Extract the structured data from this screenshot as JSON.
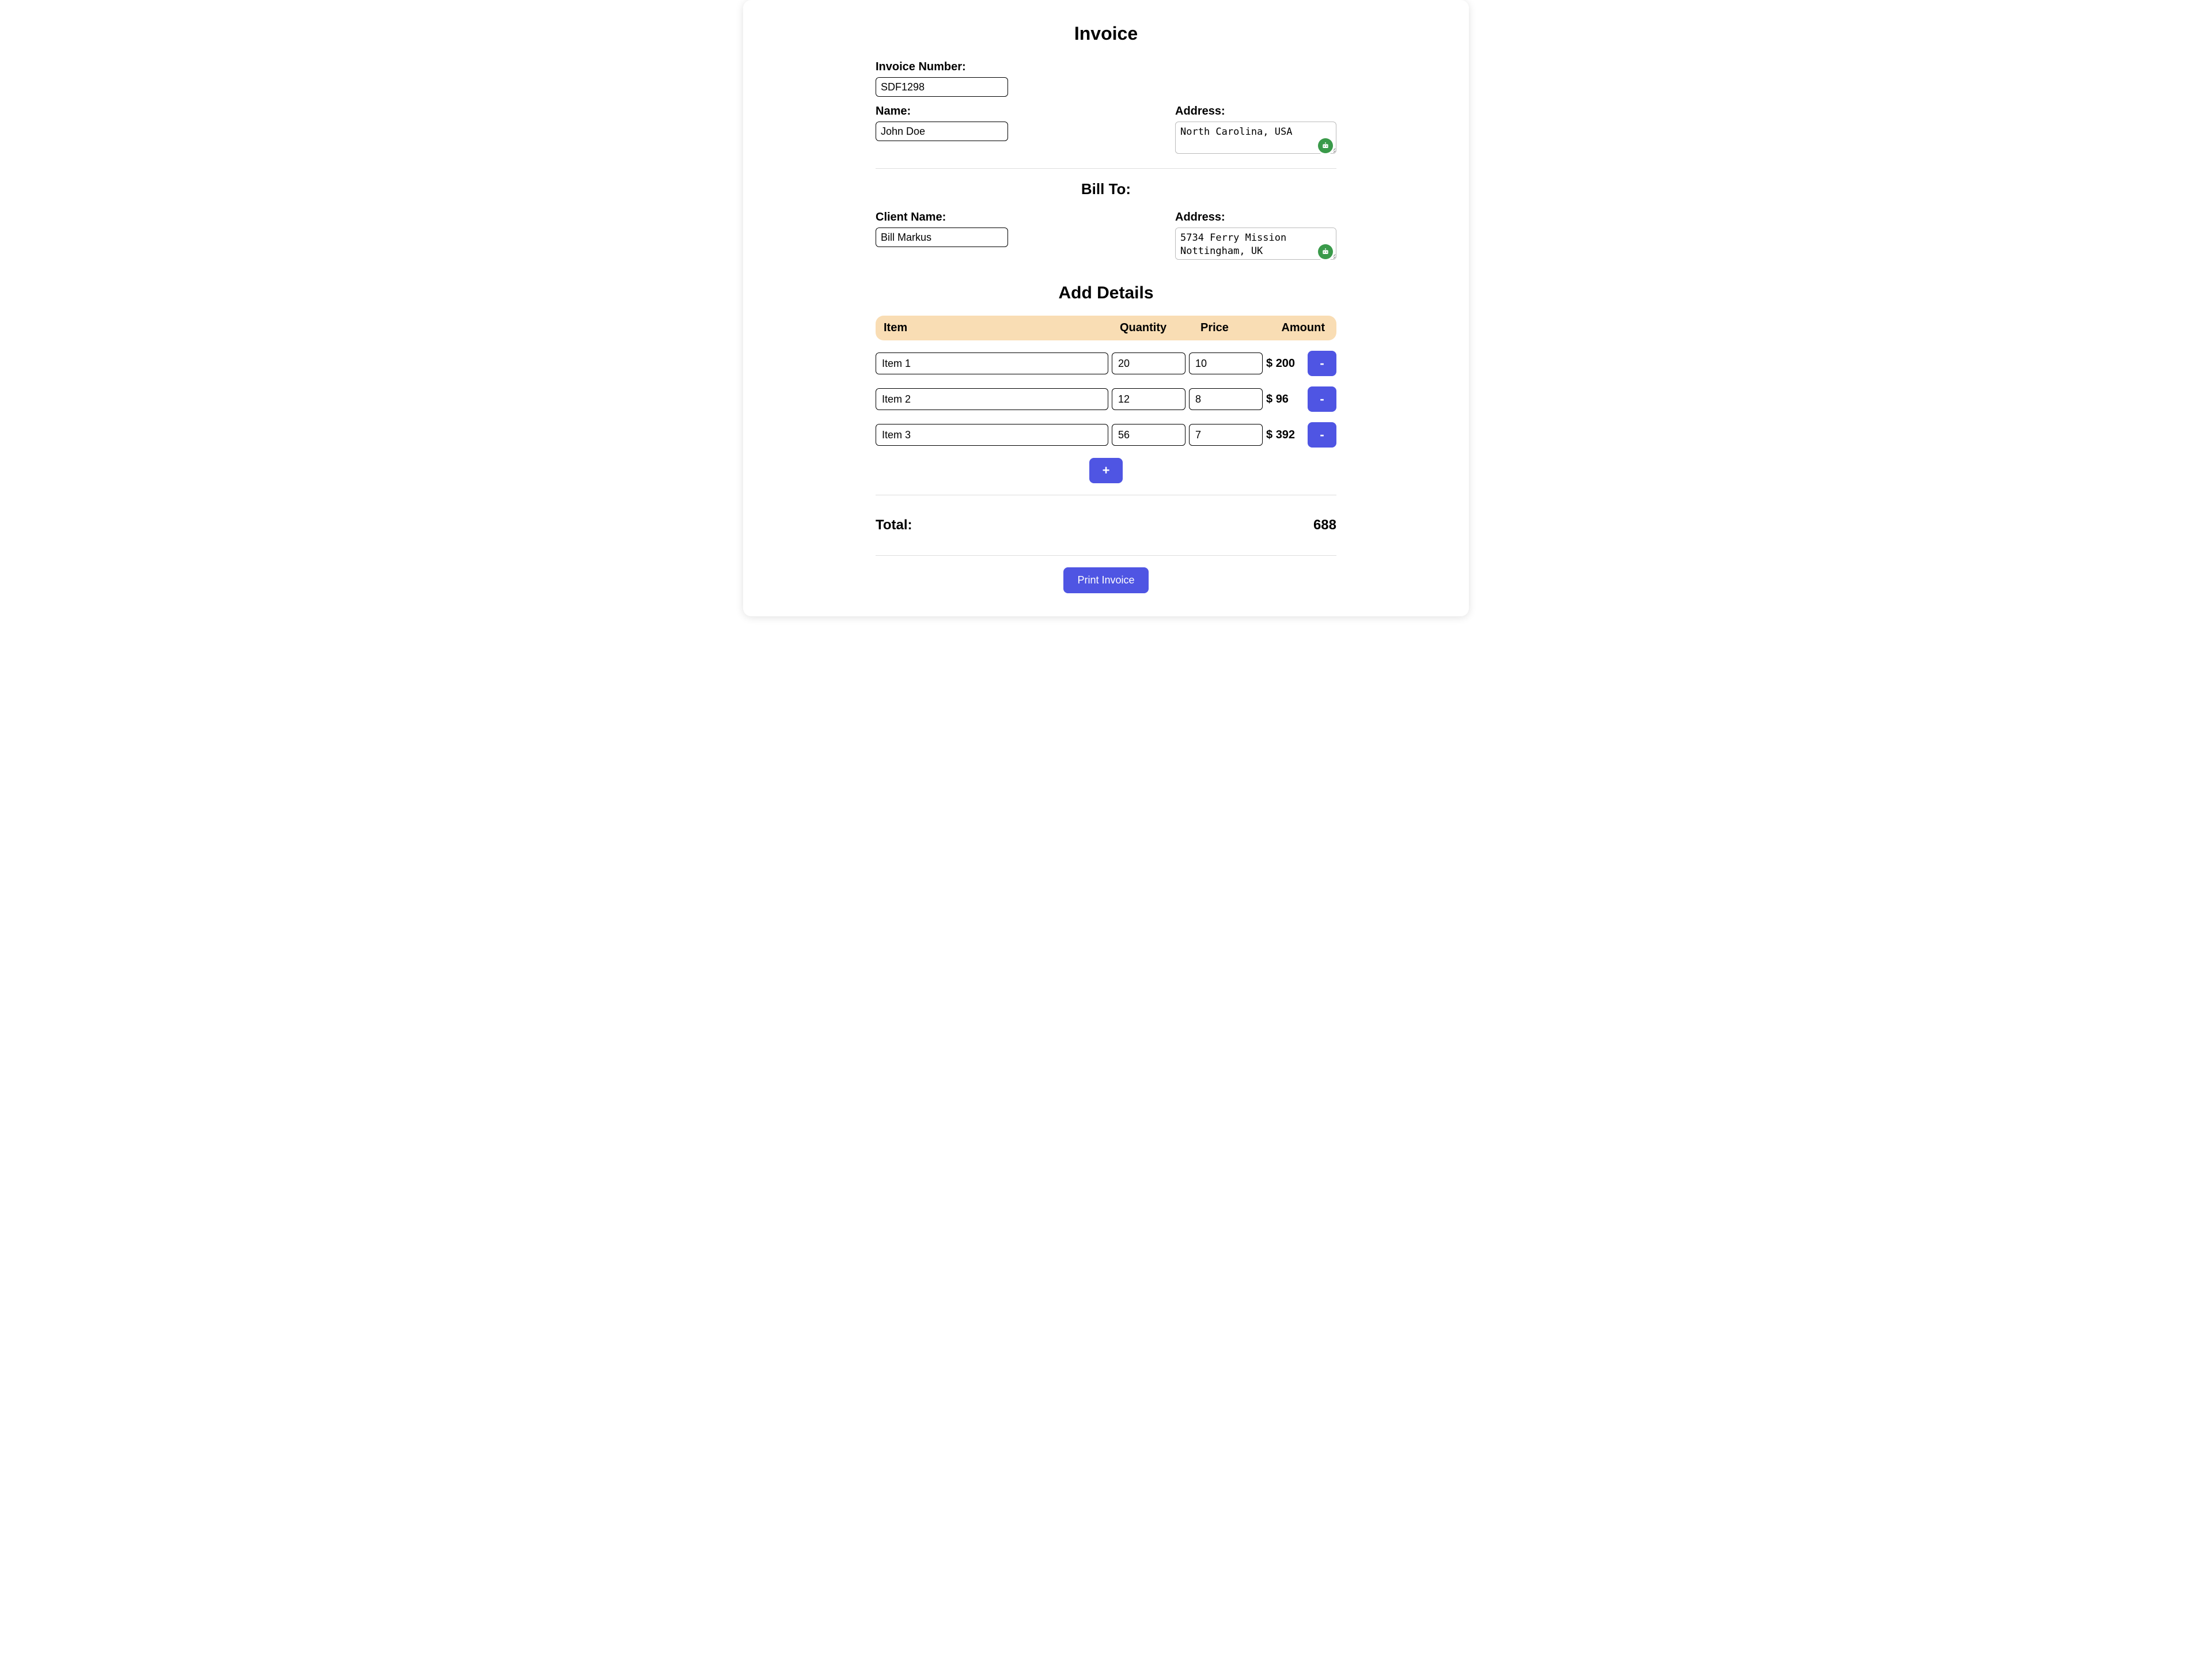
{
  "title": "Invoice",
  "invoice": {
    "number_label": "Invoice Number:",
    "number_value": "SDF1298",
    "name_label": "Name:",
    "name_value": "John Doe",
    "address_label": "Address:",
    "address_value": "North Carolina, USA"
  },
  "bill_to": {
    "heading": "Bill To:",
    "client_name_label": "Client Name:",
    "client_name_value": "Bill Markus",
    "address_label": "Address:",
    "address_value": "5734 Ferry Mission Nottingham, UK"
  },
  "details": {
    "heading": "Add Details",
    "columns": {
      "item": "Item",
      "quantity": "Quantity",
      "price": "Price",
      "amount": "Amount"
    },
    "currency_prefix": "$ ",
    "items": [
      {
        "name": "Item 1",
        "quantity": "20",
        "price": "10",
        "amount": "200"
      },
      {
        "name": "Item 2",
        "quantity": "12",
        "price": "8",
        "amount": "96"
      },
      {
        "name": "Item 3",
        "quantity": "56",
        "price": "7",
        "amount": "392"
      }
    ],
    "remove_label": "-",
    "add_label": "+"
  },
  "total": {
    "label": "Total:",
    "value": "688"
  },
  "print_label": "Print Invoice"
}
